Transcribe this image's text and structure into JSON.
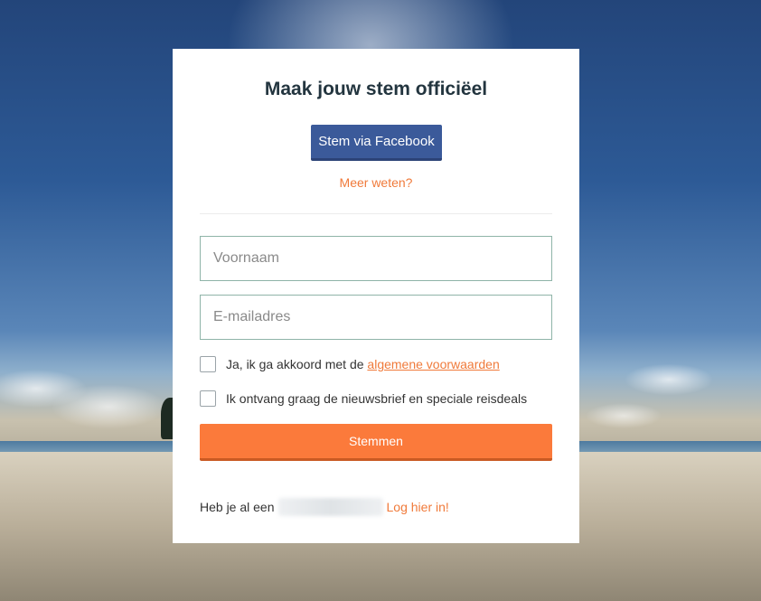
{
  "form": {
    "title": "Maak jouw stem officiëel",
    "facebook_button": "Stem via Facebook",
    "more_link": "Meer weten?",
    "first_name_placeholder": "Voornaam",
    "email_placeholder": "E-mailadres",
    "terms_prefix": "Ja, ik ga akkoord met de ",
    "terms_link": "algemene voorwaarden",
    "newsletter_label": "Ik ontvang graag de nieuwsbrief en speciale reisdeals",
    "submit_button": "Stemmen",
    "login_prefix": "Heb je al een",
    "login_link": "Log hier in!"
  },
  "colors": {
    "facebook": "#3b5a9a",
    "accent": "#fb7a3b",
    "link": "#f07a3a",
    "title": "#23353f"
  }
}
